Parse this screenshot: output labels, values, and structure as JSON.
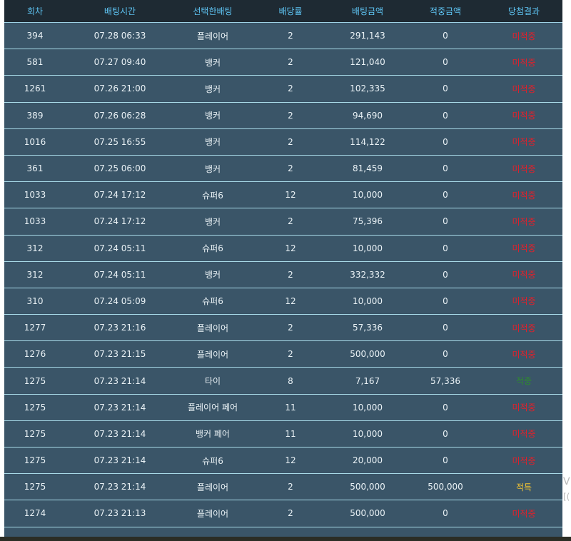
{
  "table": {
    "headers": [
      "회차",
      "배팅시간",
      "선택한배팅",
      "배당률",
      "배팅금액",
      "적중금액",
      "당첨결과"
    ],
    "rows": [
      {
        "round": "394",
        "time": "07.28 06:33",
        "choice": "플레이어",
        "odds": "2",
        "bet": "291,143",
        "win": "0",
        "result": "미적중",
        "result_color": "#e3202a"
      },
      {
        "round": "581",
        "time": "07.27 09:40",
        "choice": "뱅커",
        "odds": "2",
        "bet": "121,040",
        "win": "0",
        "result": "미적중",
        "result_color": "#e3202a"
      },
      {
        "round": "1261",
        "time": "07.26 21:00",
        "choice": "뱅커",
        "odds": "2",
        "bet": "102,335",
        "win": "0",
        "result": "미적중",
        "result_color": "#e3202a"
      },
      {
        "round": "389",
        "time": "07.26 06:28",
        "choice": "뱅커",
        "odds": "2",
        "bet": "94,690",
        "win": "0",
        "result": "미적중",
        "result_color": "#e3202a"
      },
      {
        "round": "1016",
        "time": "07.25 16:55",
        "choice": "뱅커",
        "odds": "2",
        "bet": "114,122",
        "win": "0",
        "result": "미적중",
        "result_color": "#e3202a"
      },
      {
        "round": "361",
        "time": "07.25 06:00",
        "choice": "뱅커",
        "odds": "2",
        "bet": "81,459",
        "win": "0",
        "result": "미적중",
        "result_color": "#e3202a"
      },
      {
        "round": "1033",
        "time": "07.24 17:12",
        "choice": "슈퍼6",
        "odds": "12",
        "bet": "10,000",
        "win": "0",
        "result": "미적중",
        "result_color": "#e3202a"
      },
      {
        "round": "1033",
        "time": "07.24 17:12",
        "choice": "뱅커",
        "odds": "2",
        "bet": "75,396",
        "win": "0",
        "result": "미적중",
        "result_color": "#e3202a"
      },
      {
        "round": "312",
        "time": "07.24 05:11",
        "choice": "슈퍼6",
        "odds": "12",
        "bet": "10,000",
        "win": "0",
        "result": "미적중",
        "result_color": "#e3202a"
      },
      {
        "round": "312",
        "time": "07.24 05:11",
        "choice": "뱅커",
        "odds": "2",
        "bet": "332,332",
        "win": "0",
        "result": "미적중",
        "result_color": "#e3202a"
      },
      {
        "round": "310",
        "time": "07.24 05:09",
        "choice": "슈퍼6",
        "odds": "12",
        "bet": "10,000",
        "win": "0",
        "result": "미적중",
        "result_color": "#e3202a"
      },
      {
        "round": "1277",
        "time": "07.23 21:16",
        "choice": "플레이어",
        "odds": "2",
        "bet": "57,336",
        "win": "0",
        "result": "미적중",
        "result_color": "#e3202a"
      },
      {
        "round": "1276",
        "time": "07.23 21:15",
        "choice": "플레이어",
        "odds": "2",
        "bet": "500,000",
        "win": "0",
        "result": "미적중",
        "result_color": "#e3202a"
      },
      {
        "round": "1275",
        "time": "07.23 21:14",
        "choice": "타이",
        "odds": "8",
        "bet": "7,167",
        "win": "57,336",
        "result": "적중",
        "result_color": "#2e8b2e"
      },
      {
        "round": "1275",
        "time": "07.23 21:14",
        "choice": "플레이어 페어",
        "odds": "11",
        "bet": "10,000",
        "win": "0",
        "result": "미적중",
        "result_color": "#e3202a"
      },
      {
        "round": "1275",
        "time": "07.23 21:14",
        "choice": "뱅커 페어",
        "odds": "11",
        "bet": "10,000",
        "win": "0",
        "result": "미적중",
        "result_color": "#e3202a"
      },
      {
        "round": "1275",
        "time": "07.23 21:14",
        "choice": "슈퍼6",
        "odds": "12",
        "bet": "20,000",
        "win": "0",
        "result": "미적중",
        "result_color": "#e3202a"
      },
      {
        "round": "1275",
        "time": "07.23 21:14",
        "choice": "플레이어",
        "odds": "2",
        "bet": "500,000",
        "win": "500,000",
        "result": "적특",
        "result_color": "#f1c232"
      },
      {
        "round": "1274",
        "time": "07.23 21:13",
        "choice": "플레이어",
        "odds": "2",
        "bet": "500,000",
        "win": "0",
        "result": "미적중",
        "result_color": "#e3202a"
      }
    ]
  },
  "edge_text": [
    "V",
    "[("
  ],
  "colors": {
    "header_bg": "#1e2a33",
    "header_text": "#5ec4f3",
    "row_bg": "#3a5568",
    "row_text": "#eaf2f6",
    "row_divider": "#a9dbe9"
  }
}
